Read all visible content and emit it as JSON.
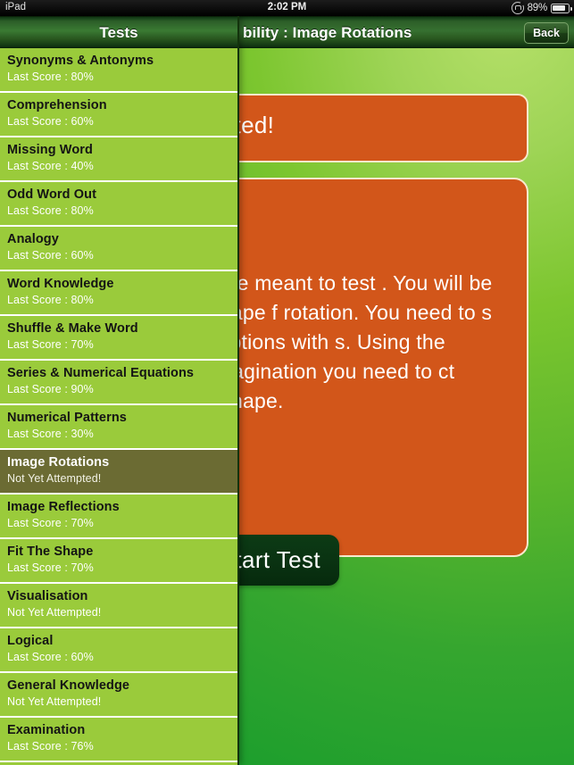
{
  "statusbar": {
    "device_label": "iPad",
    "time": "2:02 PM",
    "battery_percent": "89%",
    "rotation_lock_icon": "rotation-lock-icon",
    "battery_icon": "battery-icon"
  },
  "navbar": {
    "title": "bility : Image Rotations",
    "back_label": "Back"
  },
  "sidebar": {
    "header_title": "Tests",
    "items": [
      {
        "title": "Synonyms & Antonyms",
        "sub": "Last Score : 80%",
        "selected": false
      },
      {
        "title": "Comprehension",
        "sub": "Last Score : 60%",
        "selected": false
      },
      {
        "title": "Missing Word",
        "sub": "Last Score : 40%",
        "selected": false
      },
      {
        "title": "Odd Word Out",
        "sub": "Last Score : 80%",
        "selected": false
      },
      {
        "title": "Analogy",
        "sub": "Last Score : 60%",
        "selected": false
      },
      {
        "title": "Word Knowledge",
        "sub": "Last Score : 80%",
        "selected": false
      },
      {
        "title": "Shuffle & Make Word",
        "sub": "Last Score : 70%",
        "selected": false
      },
      {
        "title": "Series & Numerical Equations",
        "sub": "Last Score : 90%",
        "selected": false
      },
      {
        "title": "Numerical Patterns",
        "sub": "Last Score : 30%",
        "selected": false
      },
      {
        "title": "Image Rotations",
        "sub": "Not Yet Attempted!",
        "selected": true
      },
      {
        "title": "Image Reflections",
        "sub": "Last Score : 70%",
        "selected": false
      },
      {
        "title": "Fit The Shape",
        "sub": "Last Score : 70%",
        "selected": false
      },
      {
        "title": "Visualisation",
        "sub": "Not Yet Attempted!",
        "selected": false
      },
      {
        "title": "Logical",
        "sub": "Last Score : 60%",
        "selected": false
      },
      {
        "title": "General Knowledge",
        "sub": "Not Yet Attempted!",
        "selected": false
      },
      {
        "title": "Examination",
        "sub": "Last Score : 76%",
        "selected": false
      }
    ]
  },
  "main": {
    "status_text": "et Attempted!",
    "description": "his topic are meant to test . You will be given a shape f rotation. You need to s from the options with s. Using the question nagination you need to ct resulting shape.",
    "start_label": "Start Test"
  },
  "colors": {
    "accent_orange": "#d2561a",
    "panel_border": "#f7e9cd",
    "sidebar_green": "#9acb3b",
    "selected_olive": "#6b6b33",
    "navbar_green": "#2c5e28",
    "start_button": "#0a3312"
  }
}
